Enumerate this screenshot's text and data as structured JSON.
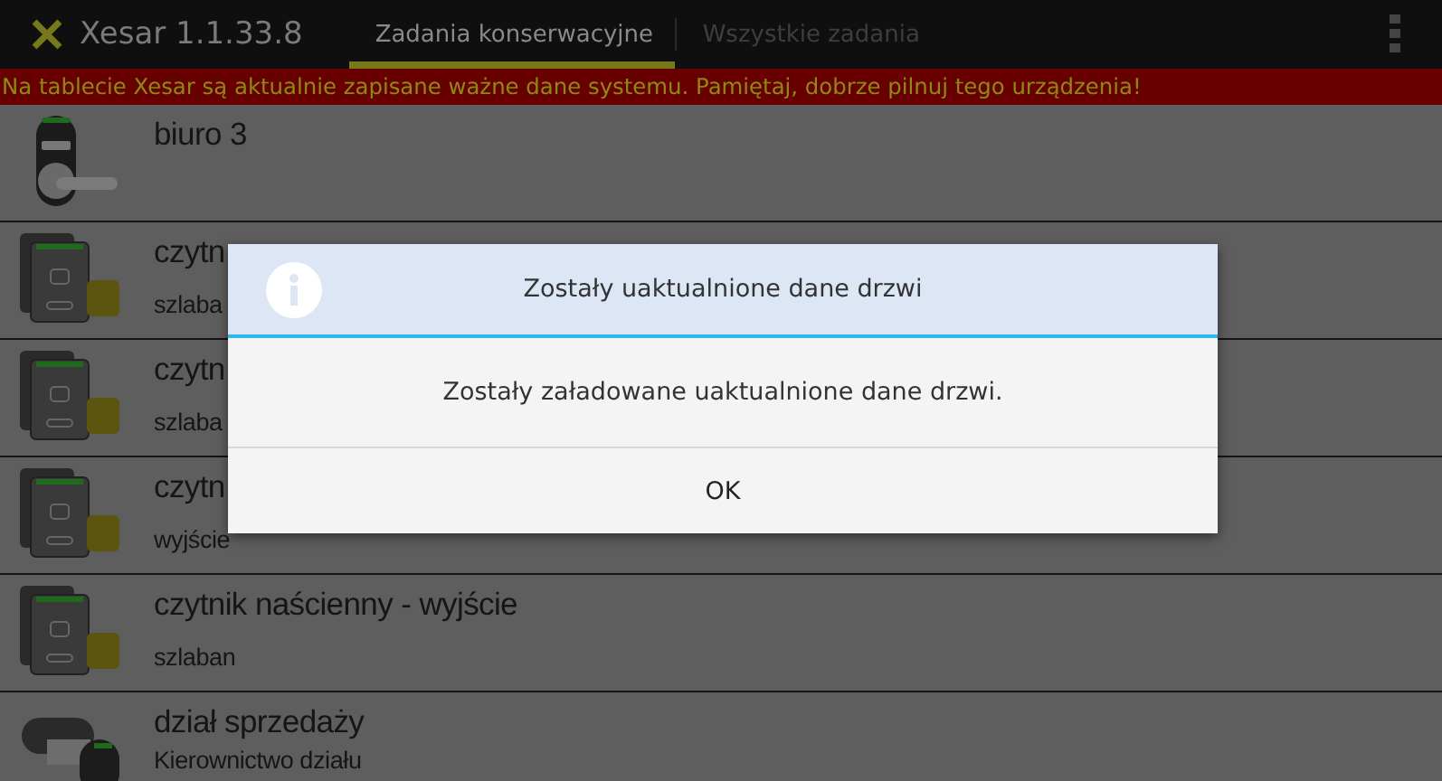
{
  "action_bar": {
    "app_title": "Xesar 1.1.33.8",
    "tabs": [
      {
        "label": "Zadania konserwacyjne",
        "selected": true
      },
      {
        "label": "Wszystkie zadania",
        "selected": false
      }
    ]
  },
  "warning_banner": "Na tablecie Xesar są aktualnie zapisane ważne dane systemu. Pamiętaj, dobrze pilnuj tego urządzenia!",
  "doors": [
    {
      "kind": "handle",
      "title": "biuro 3"
    },
    {
      "kind": "reader",
      "title": "czytn",
      "subtitle": "szlaba"
    },
    {
      "kind": "reader",
      "title": "czytn",
      "subtitle": "szlaba"
    },
    {
      "kind": "reader",
      "title": "czytn",
      "subtitle": "wyjście"
    },
    {
      "kind": "reader",
      "title": "czytnik naścienny - wyjście",
      "subtitle": "szlaban"
    },
    {
      "kind": "cylinder",
      "title": "dział sprzedaży",
      "subtitle": "Kierownictwo działu"
    }
  ],
  "dialog": {
    "title": "Zostały uaktualnione dane drzwi",
    "message": "Zostały załadowane uaktualnione dane drzwi.",
    "button": "OK"
  }
}
